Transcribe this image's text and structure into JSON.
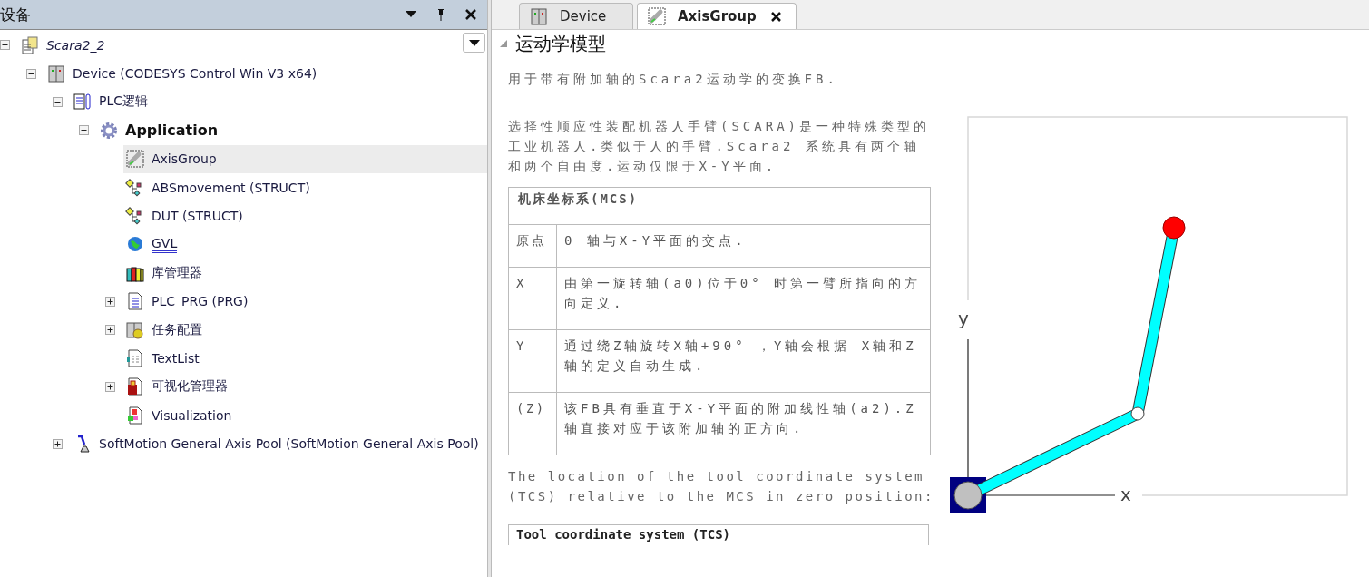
{
  "panel": {
    "title": "设备",
    "tree": [
      {
        "label": "Scara2_2",
        "kind": "project",
        "expanded": true,
        "selected": false,
        "children": [
          {
            "label": "Device (CODESYS Control Win V3 x64)",
            "kind": "device",
            "expanded": true,
            "selected": false,
            "children": [
              {
                "label": "PLC逻辑",
                "kind": "plc-logic",
                "expanded": true,
                "selected": false,
                "children": [
                  {
                    "label": "Application",
                    "kind": "application",
                    "expanded": true,
                    "selected": false,
                    "children": [
                      {
                        "label": "AxisGroup",
                        "kind": "axis-group",
                        "selected": true
                      },
                      {
                        "label": "ABSmovement (STRUCT)",
                        "kind": "struct",
                        "selected": false
                      },
                      {
                        "label": "DUT (STRUCT)",
                        "kind": "struct",
                        "selected": false
                      },
                      {
                        "label": "GVL",
                        "kind": "gvl",
                        "selected": false
                      },
                      {
                        "label": "库管理器",
                        "kind": "library",
                        "selected": false
                      },
                      {
                        "label": "PLC_PRG (PRG)",
                        "kind": "program",
                        "expanded": false,
                        "selected": false
                      },
                      {
                        "label": "任务配置",
                        "kind": "task",
                        "expanded": false,
                        "selected": false
                      },
                      {
                        "label": "TextList",
                        "kind": "textlist",
                        "selected": false
                      },
                      {
                        "label": "可视化管理器",
                        "kind": "visu-manager",
                        "expanded": false,
                        "selected": false
                      },
                      {
                        "label": "Visualization",
                        "kind": "visualization",
                        "selected": false
                      }
                    ]
                  }
                ]
              },
              {
                "label": "SoftMotion General Axis Pool (SoftMotion General Axis Pool)",
                "kind": "axis-pool",
                "expanded": false,
                "selected": false
              }
            ]
          }
        ]
      }
    ]
  },
  "editor": {
    "tabs": [
      {
        "label": "Device",
        "kind": "device",
        "selected": false
      },
      {
        "label": "AxisGroup",
        "kind": "axis-group",
        "selected": true
      }
    ],
    "section": {
      "title": "运动学模型",
      "expanded": true
    },
    "intro": "用于带有附加轴的Scara2运动学的变换FB.",
    "description": "选择性顺应性装配机器人手臂(SCARA)是一种特殊类型的工业机器人.类似于人的手臂.Scara2 系统具有两个轴和两个自由度.运动仅限于X-Y平面.",
    "mcs_table": {
      "title": "机床坐标系(MCS)",
      "rows": [
        {
          "label": "原点",
          "text": "0 轴与X-Y平面的交点."
        },
        {
          "label": "X",
          "text": "由第一旋转轴(a0)位于0° 时第一臂所指向的方向定义."
        },
        {
          "label": "Y",
          "text": "通过绕Z轴旋转X轴+90° ，Y轴会根据 X轴和Z轴的定义自动生成."
        },
        {
          "label": "(Z)",
          "text": "该FB具有垂直于X-Y平面的附加线性轴(a2).Z轴直接对应于该附加轴的正方向."
        }
      ]
    },
    "tcs_text": "The location of the tool coordinate system (TCS) relative to the MCS in zero position:",
    "tcs_table": {
      "title": "Tool coordinate system (TCS)"
    },
    "diagram": {
      "y_label": "y",
      "x_label": "x"
    }
  }
}
